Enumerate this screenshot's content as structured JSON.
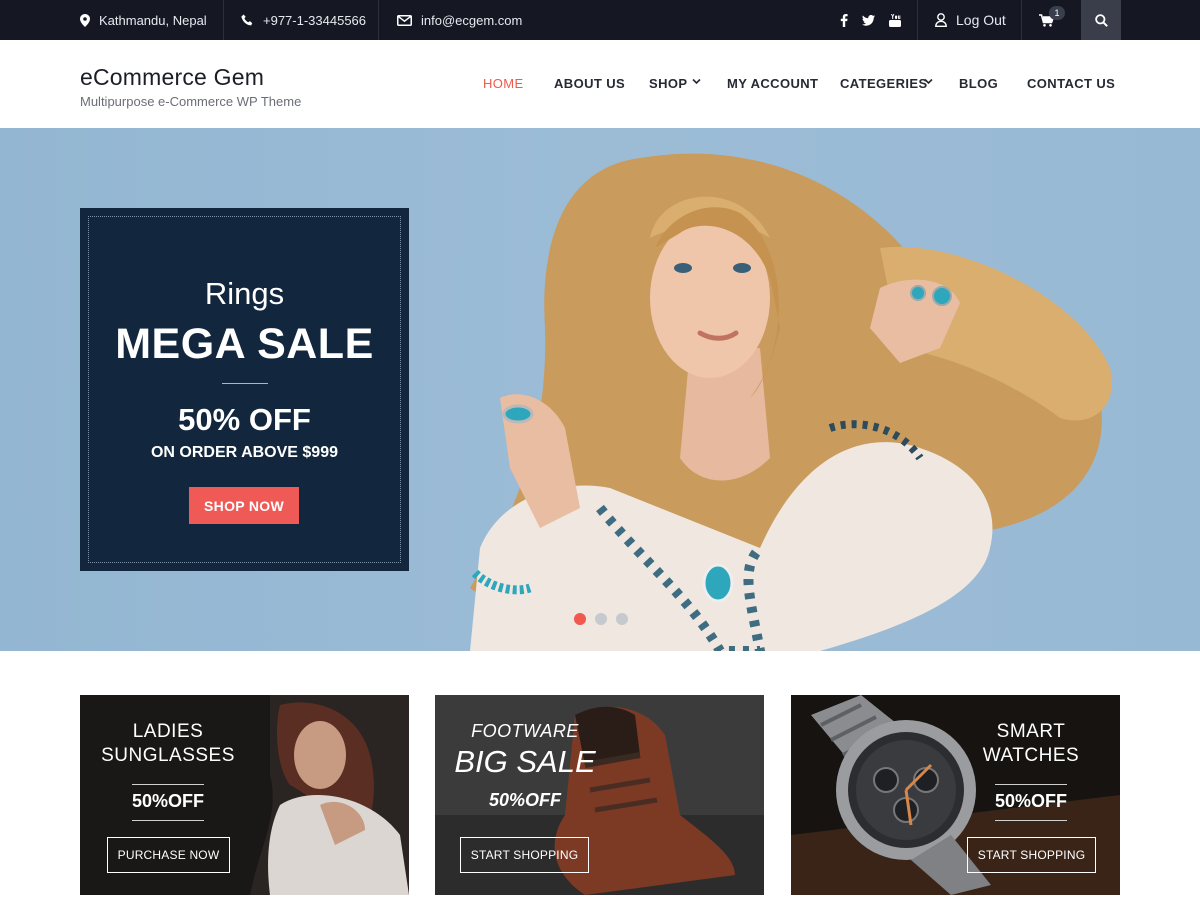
{
  "topbar": {
    "location": "Kathmandu, Nepal",
    "phone": "+977-1-33445566",
    "email": "info@ecgem.com",
    "logout_label": "Log Out",
    "cart_count": "1",
    "social_icons": [
      "facebook-icon",
      "twitter-icon",
      "youtube-icon"
    ]
  },
  "header": {
    "site_title": "eCommerce Gem",
    "tagline": "Multipurpose e-Commerce WP Theme"
  },
  "nav": {
    "items": [
      {
        "label": "HOME",
        "active": true
      },
      {
        "label": "ABOUT US"
      },
      {
        "label": "SHOP",
        "has_dropdown": true
      },
      {
        "label": "MY ACCOUNT"
      },
      {
        "label": "CATEGERIES",
        "has_dropdown": true
      },
      {
        "label": "BLOG"
      },
      {
        "label": "CONTACT US"
      }
    ]
  },
  "hero": {
    "subtitle": "Rings",
    "title": "MEGA SALE",
    "discount": "50% OFF",
    "condition": "ON ORDER ABOVE $999",
    "button_label": "SHOP NOW",
    "slides": 3,
    "active_slide": 1
  },
  "cards": [
    {
      "heading_line1": "LADIES",
      "heading_line2": "SUNGLASSES",
      "discount": "50%OFF",
      "button_label": "PURCHASE NOW"
    },
    {
      "heading_line1": "FOOTWARE",
      "heading_line2": "BIG SALE",
      "discount": "50%OFF",
      "button_label": "START SHOPPING"
    },
    {
      "heading_line1": "SMART",
      "heading_line2": "WATCHES",
      "discount": "50%OFF",
      "button_label": "START SHOPPING"
    }
  ],
  "colors": {
    "accent": "#f0594b",
    "topbar_bg": "#151823",
    "promo_bg": "#12263d",
    "hero_bg": "#9cbcd6"
  }
}
